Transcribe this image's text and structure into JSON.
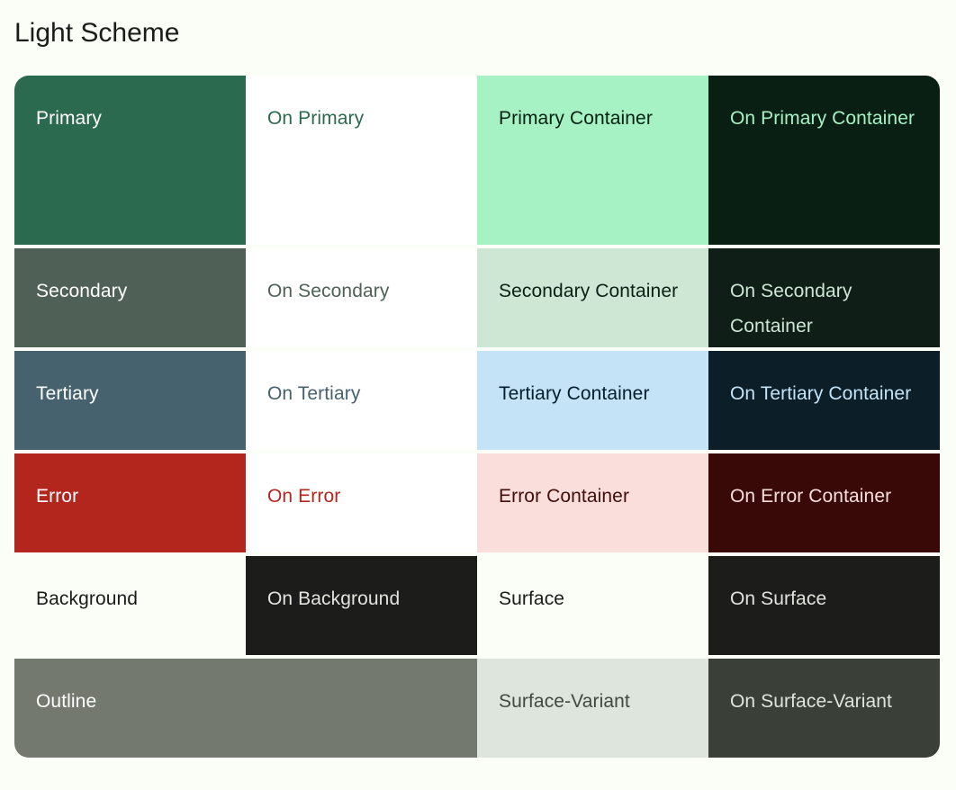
{
  "page": {
    "background_color": "#FBFDF7",
    "title": "Light Scheme",
    "title_color": "#1A1C19"
  },
  "rows": [
    {
      "name": "primary",
      "swatches": [
        {
          "label": "Primary",
          "bg": "#2C6A4F",
          "fg": "#FFFFFF"
        },
        {
          "label": "On Primary",
          "bg": "#FFFFFF",
          "fg": "#2C6A4F"
        },
        {
          "label": "Primary Container",
          "bg": "#A6F2C5",
          "fg": "#002110"
        },
        {
          "label": "On Primary Container",
          "bg": "#0A1F14",
          "fg": "#A6F2C5"
        }
      ]
    },
    {
      "name": "secondary",
      "swatches": [
        {
          "label": "Secondary",
          "bg": "#4F6156",
          "fg": "#FFFFFF"
        },
        {
          "label": "On Secondary",
          "bg": "#FFFFFF",
          "fg": "#4F6156"
        },
        {
          "label": "Secondary Container",
          "bg": "#CEE7D5",
          "fg": "#0B1F14"
        },
        {
          "label": "On Secondary Container",
          "bg": "#0F1F17",
          "fg": "#CEE7D5"
        }
      ]
    },
    {
      "name": "tertiary",
      "swatches": [
        {
          "label": "Tertiary",
          "bg": "#47626F",
          "fg": "#FFFFFF"
        },
        {
          "label": "On Tertiary",
          "bg": "#FFFFFF",
          "fg": "#47626F"
        },
        {
          "label": "Tertiary Container",
          "bg": "#C5E3F6",
          "fg": "#001E2B"
        },
        {
          "label": "On Tertiary Container",
          "bg": "#0C1E28",
          "fg": "#C5E3F6"
        }
      ]
    },
    {
      "name": "error",
      "swatches": [
        {
          "label": "Error",
          "bg": "#B3261E",
          "fg": "#FFFFFF"
        },
        {
          "label": "On Error",
          "bg": "#FFFFFF",
          "fg": "#B3261E"
        },
        {
          "label": "Error Container",
          "bg": "#F9DEDC",
          "fg": "#410E0B"
        },
        {
          "label": "On Error Container",
          "bg": "#380906",
          "fg": "#F9DEDC"
        }
      ]
    },
    {
      "name": "background",
      "swatches": [
        {
          "label": "Background",
          "bg": "transparent",
          "fg": "#1A1C19"
        },
        {
          "label": "On Background",
          "bg": "#1C1D1A",
          "fg": "#E2E3DD"
        },
        {
          "label": "Surface",
          "bg": "transparent",
          "fg": "#1A1C19"
        },
        {
          "label": "On Surface",
          "bg": "#1C1D1A",
          "fg": "#E2E3DD"
        }
      ]
    },
    {
      "name": "outline",
      "swatches": [
        {
          "label": "Outline",
          "bg": "#74796F",
          "fg": "#FFFFFF"
        },
        {
          "label": "",
          "bg": "#74796F",
          "fg": "#FFFFFF"
        },
        {
          "label": "Surface-Variant",
          "bg": "#DEE5DC",
          "fg": "#424940"
        },
        {
          "label": "On Surface-Variant",
          "bg": "#3A4038",
          "fg": "#DEE5DC"
        }
      ]
    }
  ]
}
